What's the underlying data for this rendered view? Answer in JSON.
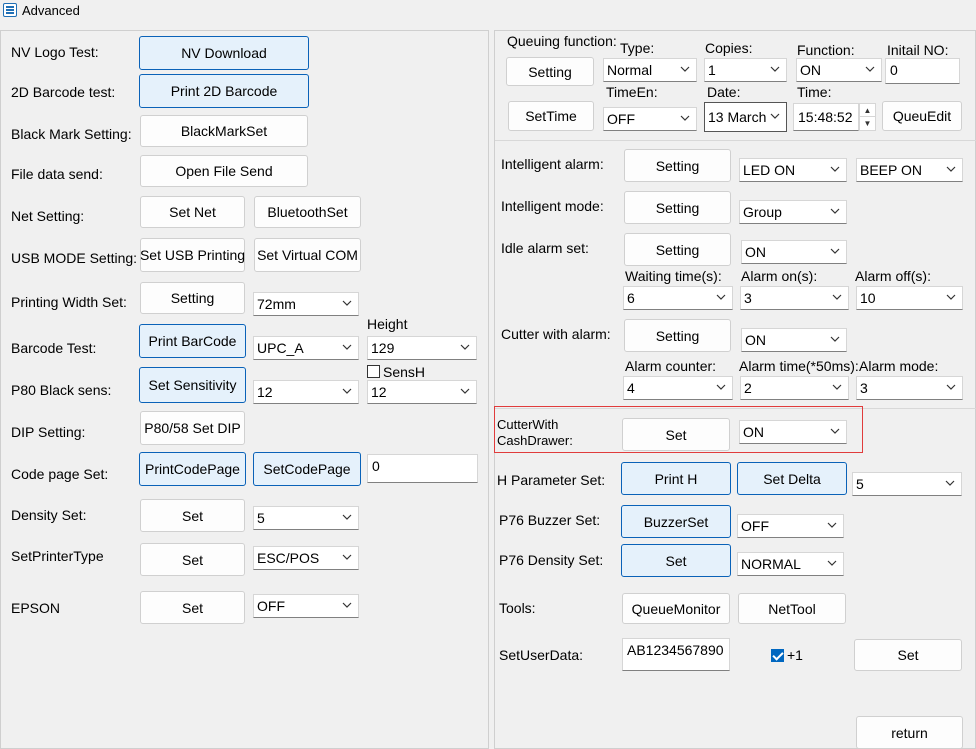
{
  "window": {
    "title": "Advanced"
  },
  "left": {
    "nv_logo": {
      "label": "NV Logo Test:",
      "button": "NV Download"
    },
    "barcode2d": {
      "label": "2D Barcode test:",
      "button": "Print 2D Barcode"
    },
    "black_mark": {
      "label": "Black Mark Setting:",
      "button": "BlackMarkSet"
    },
    "file_send": {
      "label": "File data send:",
      "button": "Open File Send"
    },
    "net": {
      "label": "Net Setting:",
      "button1": "Set Net",
      "button2": "BluetoothSet"
    },
    "usb": {
      "label": "USB MODE Setting:",
      "button1": "Set USB Printing",
      "button2": "Set Virtual COM"
    },
    "width": {
      "label": "Printing Width Set:",
      "button": "Setting",
      "select": "72mm"
    },
    "barcode": {
      "label": "Barcode Test:",
      "button": "Print BarCode",
      "select": "UPC_A",
      "height_label": "Height",
      "height_select": "129"
    },
    "black_sens": {
      "label": "P80 Black sens:",
      "button": "Set Sensitivity",
      "select": "12",
      "sensh_label": "SensH",
      "sensh_checked": false,
      "sensh_select": "12"
    },
    "dip": {
      "label": "DIP Setting:",
      "button": "P80/58 Set DIP"
    },
    "code_page": {
      "label": "Code page Set:",
      "button1": "PrintCodePage",
      "button2": "SetCodePage",
      "input": "0"
    },
    "density": {
      "label": "Density Set:",
      "button": "Set",
      "select": "5"
    },
    "printer_type": {
      "label": "SetPrinterType",
      "button": "Set",
      "select": "ESC/POS"
    },
    "epson": {
      "label": "EPSON",
      "button": "Set",
      "select": "OFF"
    }
  },
  "queue": {
    "label": "Queuing function:",
    "setting_button": "Setting",
    "settime_button": "SetTime",
    "type_label": "Type:",
    "type_value": "Normal",
    "copies_label": "Copies:",
    "copies_value": "1",
    "function_label": "Function:",
    "function_value": "ON",
    "initial_label": "Initail NO:",
    "initial_value": "0",
    "timeen_label": "TimeEn:",
    "timeen_value": "OFF",
    "date_label": "Date:",
    "date_value": "13   March",
    "time_label": "Time:",
    "time_value": "15:48:52",
    "queuedit_button": "QueuEdit"
  },
  "right": {
    "intelligent_alarm": {
      "label": "Intelligent alarm:",
      "button": "Setting",
      "select1": "LED ON",
      "select2": "BEEP ON"
    },
    "intelligent_mode": {
      "label": "Intelligent mode:",
      "button": "Setting",
      "select": "Group"
    },
    "idle_alarm": {
      "label": "Idle alarm set:",
      "button": "Setting",
      "select": "ON",
      "waiting_label": "Waiting time(s):",
      "waiting_value": "6",
      "alarm_on_label": "Alarm on(s):",
      "alarm_on_value": "3",
      "alarm_off_label": "Alarm off(s):",
      "alarm_off_value": "10"
    },
    "cutter_alarm": {
      "label": "Cutter with alarm:",
      "button": "Setting",
      "select": "ON",
      "counter_label": "Alarm counter:",
      "counter_value": "4",
      "time_label": "Alarm time(*50ms):",
      "time_value": "2",
      "mode_label": "Alarm mode:",
      "mode_value": "3"
    },
    "cutter_drawer": {
      "label_line1": "CutterWith",
      "label_line2": "CashDrawer:",
      "button": "Set",
      "select": "ON"
    },
    "h_param": {
      "label": "H Parameter Set:",
      "button1": "Print H",
      "button2": "Set Delta",
      "select": "5"
    },
    "buzzer": {
      "label": "P76 Buzzer Set:",
      "button": "BuzzerSet",
      "select": "OFF"
    },
    "p76_density": {
      "label": "P76 Density Set:",
      "button": "Set",
      "select": "NORMAL"
    },
    "tools": {
      "label": "Tools:",
      "button1": "QueueMonitor",
      "button2": "NetTool"
    },
    "user_data": {
      "label": "SetUserData:",
      "input": "AB1234567890",
      "plus_label": "+1",
      "plus_checked": true,
      "button": "Set"
    },
    "return_button": "return"
  },
  "icons": {
    "chevron": "chevron-down-icon",
    "app": "app-icon"
  }
}
